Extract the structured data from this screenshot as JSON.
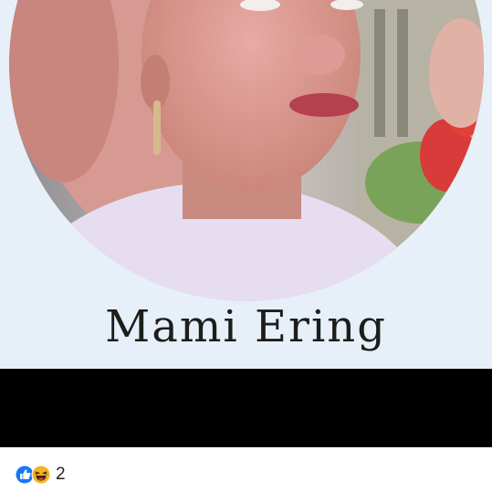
{
  "post": {
    "caption": "Mami Ering",
    "reactions": {
      "count": "2",
      "types": [
        "like-icon",
        "haha-icon"
      ],
      "like_color": "#1877f2",
      "haha_color": "#f7b125"
    }
  }
}
